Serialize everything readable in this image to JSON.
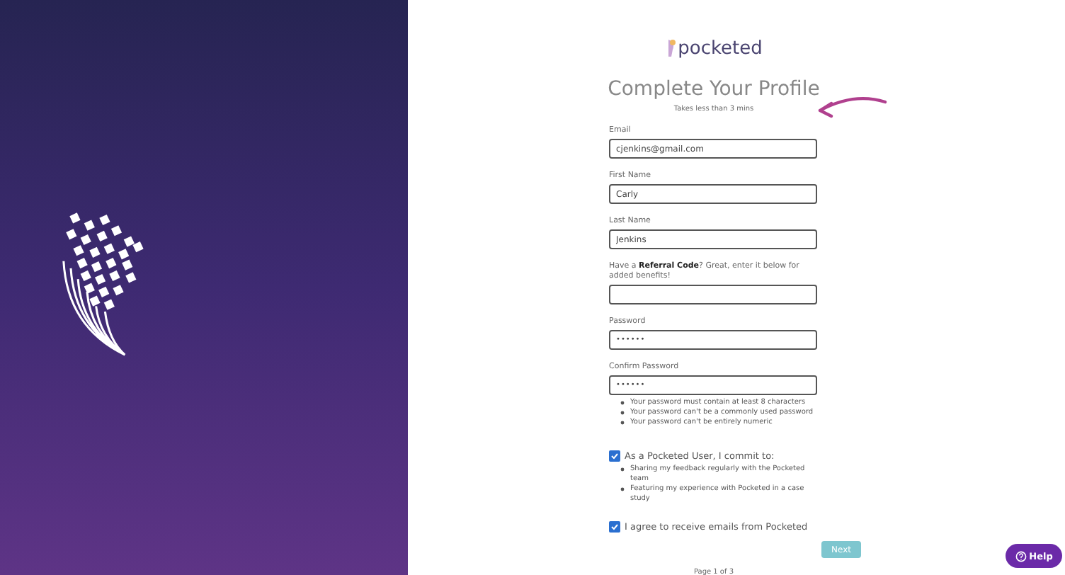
{
  "brand": {
    "name": "pocketed"
  },
  "header": {
    "title": "Complete Your Profile",
    "subtitle": "Takes less than 3 mins"
  },
  "fields": [
    {
      "kind": "text",
      "label": "Email",
      "value": "cjenkins@gmail.com"
    },
    {
      "kind": "text",
      "label": "First Name",
      "value": "Carly"
    },
    {
      "kind": "text",
      "label": "Last Name",
      "value": "Jenkins"
    },
    {
      "kind": "text",
      "label": "Have a **Referral Code**? Great, enter it below for added benefits!"
    },
    {
      "kind": "password",
      "label": "Password",
      "value": "••••••"
    },
    {
      "kind": "password",
      "label": "Confirm Password",
      "value": "••••••"
    }
  ],
  "password_rules": [
    "Your password must contain at least 8 characters",
    "Your password can't be a commonly used password",
    "Your password can't be entirely numeric"
  ],
  "commitment": {
    "checked": true,
    "label": "As a Pocketed User, I commit to:",
    "items": [
      "Sharing my feedback regularly with the Pocketed team",
      "Featuring my experience with Pocketed in a case study"
    ]
  },
  "emails_consent": {
    "checked": true,
    "label": "I agree to receive emails from Pocketed"
  },
  "next_button": "Next",
  "pagination": "Page 1 of 3",
  "help_button": "Help"
}
